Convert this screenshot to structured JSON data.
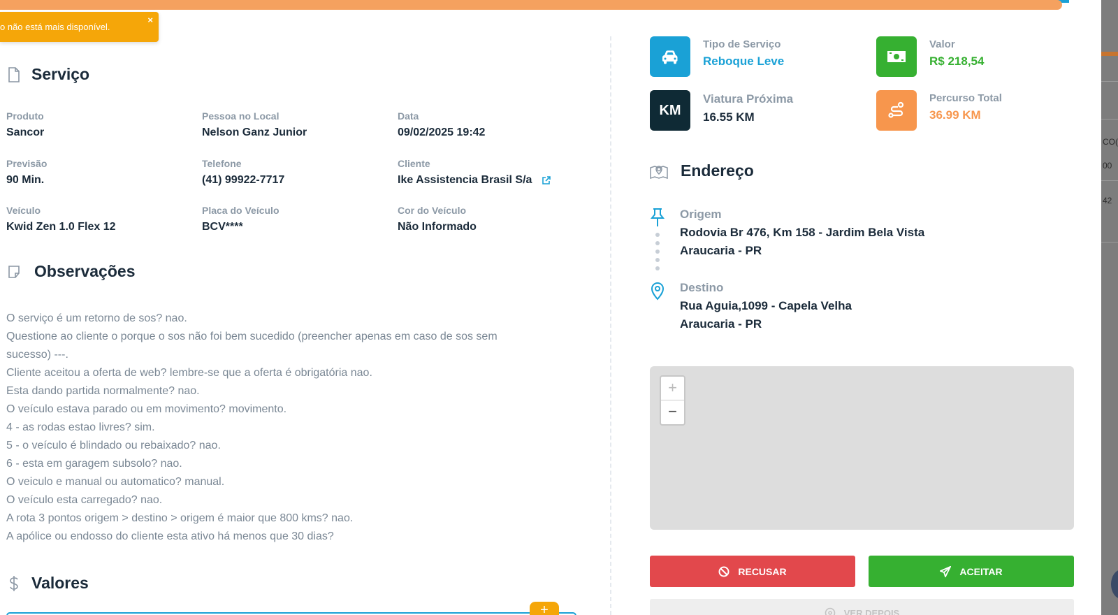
{
  "toast": {
    "message": "o não está mais disponível.",
    "close": "×"
  },
  "servico": {
    "title": "Serviço",
    "fields": [
      {
        "label": "Produto",
        "value": "Sancor"
      },
      {
        "label": "Pessoa no Local",
        "value": "Nelson Ganz Junior"
      },
      {
        "label": "Data",
        "value": "09/02/2025 19:42"
      },
      {
        "label": "Previsão",
        "value": "90 Min."
      },
      {
        "label": "Telefone",
        "value": "(41) 99922-7717"
      },
      {
        "label": "Cliente",
        "value": "Ike Assistencia Brasil S/a"
      },
      {
        "label": "Veículo",
        "value": "Kwid Zen 1.0 Flex 12"
      },
      {
        "label": "Placa do Veículo",
        "value": "BCV****"
      },
      {
        "label": "Cor do Veículo",
        "value": "Não Informado"
      }
    ]
  },
  "observacoes": {
    "title": "Observações",
    "lines": [
      "O serviço é um retorno de sos? nao.",
      "Questione ao cliente o porque o sos não foi bem sucedido (preencher apenas em caso de sos sem",
      "sucesso) ---.",
      "Cliente aceitou a oferta de web? lembre-se que a oferta é obrigatória nao.",
      "Esta dando partida normalmente? nao.",
      "O veículo estava parado ou em movimento? movimento.",
      "4 - as rodas estao livres? sim.",
      "5 - o veículo é blindado ou rebaixado? nao.",
      "6 - esta em garagem subsolo? nao.",
      "O veiculo e manual ou automatico? manual.",
      "O veículo esta carregado? nao.",
      "A rota 3 pontos origem > destino > origem é maior que 800 kms? nao.",
      "A apólice ou endosso do cliente esta ativo há menos que 30 dias?"
    ]
  },
  "valores": {
    "title": "Valores",
    "add": "+"
  },
  "info": {
    "tipo": {
      "label": "Tipo de Serviço",
      "value": "Reboque Leve",
      "color": "#1aa1d6",
      "icon": "car-icon"
    },
    "valor": {
      "label": "Valor",
      "value": "R$ 218,54",
      "color": "#36b031",
      "icon": "money-icon"
    },
    "viatura": {
      "label": "Viatura Próxima",
      "value": "16.55 KM",
      "color": "#0f2a35",
      "icon": "km-icon",
      "tile_text": "KM"
    },
    "percurso": {
      "label": "Percurso Total",
      "value": "36.99 KM",
      "color": "#f7964d",
      "icon": "route-icon"
    }
  },
  "endereco": {
    "title": "Endereço",
    "origem": {
      "label": "Origem",
      "line1": "Rodovia Br 476, Km 158 - Jardim Bela Vista",
      "line2": "Araucaria - PR"
    },
    "destino": {
      "label": "Destino",
      "line1": "Rua Aguia,1099 - Capela Velha",
      "line2": "Araucaria - PR"
    }
  },
  "map": {
    "zoom_in": "+",
    "zoom_out": "−"
  },
  "actions": {
    "refuse": "RECUSAR",
    "accept": "ACEITAR",
    "later": "VER DEPOIS"
  },
  "progress": {
    "percent": 95
  },
  "backdrop": {
    "t1": "CO(S",
    "t2": "00",
    "t3": "42"
  },
  "colors": {
    "accent": "#1aa1d6",
    "warning": "#f5a609",
    "danger": "#e2484c",
    "success": "#36b031",
    "orange": "#f7964d"
  }
}
